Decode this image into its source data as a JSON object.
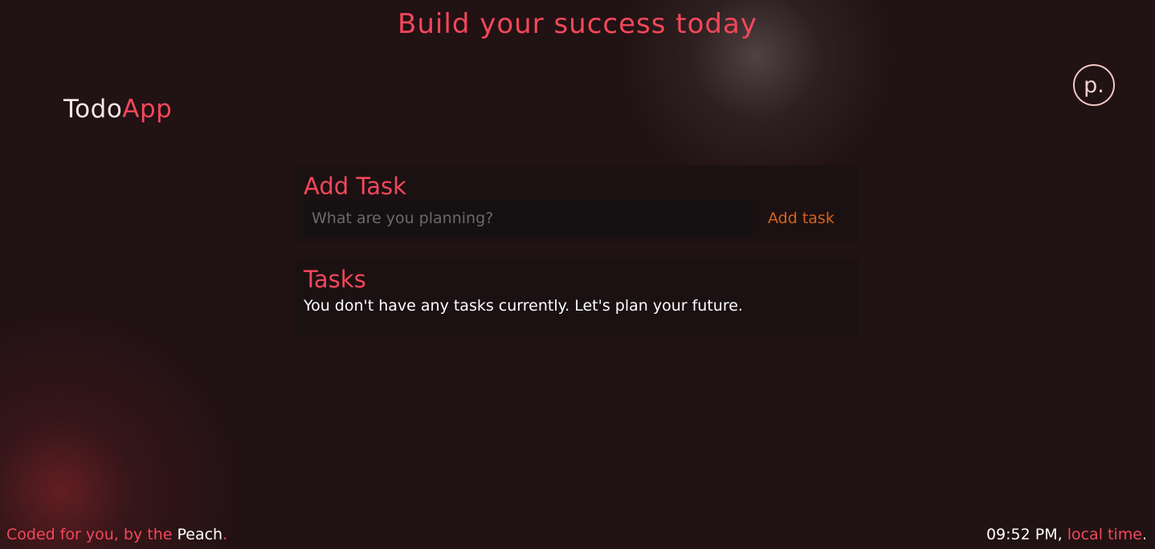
{
  "headline": "Build your success today",
  "brand": {
    "part1": "Todo",
    "part2": "App"
  },
  "avatar": {
    "initial": "p."
  },
  "add_task": {
    "title": "Add Task",
    "input_placeholder": "What are you planning?",
    "input_value": "",
    "button_label": "Add task"
  },
  "tasks": {
    "title": "Tasks",
    "empty_message": "You don't have any tasks currently. Let's plan your future.",
    "items": []
  },
  "footer": {
    "credit_prefix": "Coded for you, by the ",
    "credit_author": "Peach",
    "credit_suffix": ".",
    "time": "09:52 PM",
    "time_separator": ", ",
    "time_label": "local time",
    "time_suffix": "."
  },
  "colors": {
    "background": "#211214",
    "accent": "#f4475a",
    "button": "#d7631a",
    "panel": "#1b1113"
  }
}
